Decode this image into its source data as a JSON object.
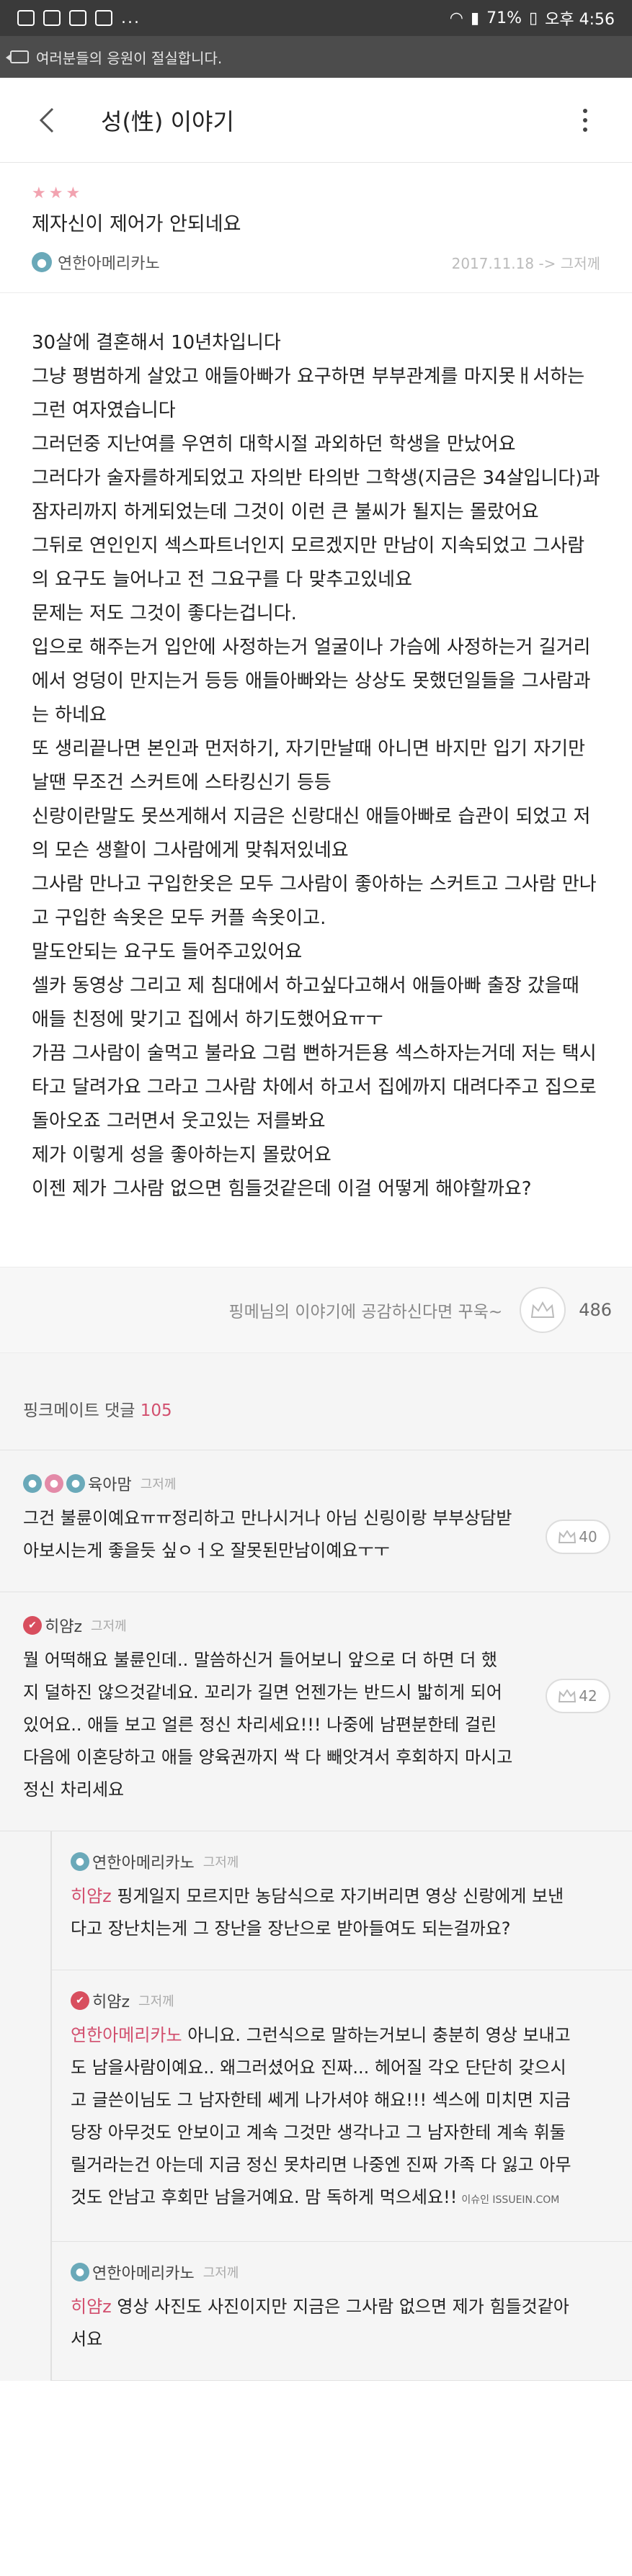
{
  "status_bar": {
    "time": "오후 4:56",
    "battery": "71%"
  },
  "notice": {
    "text": "여러분들의 응원이 절실합니다."
  },
  "header": {
    "title": "성(性) 이야기"
  },
  "post": {
    "title": "제자신이 제어가 안되네요",
    "author": "연한아메리카노",
    "date": "2017.11.18 -> 그저께",
    "paragraphs": [
      "30살에 결혼해서 10년차입니다",
      "그냥 평범하게 살았고 애들아빠가 요구하면 부부관계를 마지못ㅐ서하는 그런 여자였습니다",
      "그러던중 지난여를 우연히 대학시절 과외하던 학생을 만났어요",
      "그러다가 술자를하게되었고 자의반 타의반 그학생(지금은 34살입니다)과 잠자리까지 하게되었는데 그것이 이런 큰 불씨가 될지는 몰랐어요",
      "그뒤로 연인인지 섹스파트너인지 모르겠지만 만남이 지속되었고 그사람의 요구도 늘어나고 전 그요구를 다 맞추고있네요",
      "문제는 저도 그것이 좋다는겁니다.",
      "입으로 해주는거 입안에 사정하는거 얼굴이나 가슴에 사정하는거 길거리에서 엉덩이 만지는거 등등 애들아빠와는 상상도 못했던일들을 그사람과는 하네요",
      "또 생리끝나면 본인과 먼저하기, 자기만날때 아니면 바지만 입기 자기만날땐 무조건 스커트에 스타킹신기 등등",
      "신랑이란말도 못쓰게해서 지금은 신랑대신 애들아빠로 습관이 되었고 저의 모슨 생활이 그사람에게 맞춰저있네요",
      "그사람 만나고 구입한옷은 모두 그사람이 좋아하는 스커트고 그사람 만나고 구입한 속옷은 모두 커플 속옷이고.",
      "말도안되는 요구도 들어주고있어요",
      "셀카 동영상 그리고 제 침대에서 하고싶다고해서 애들아빠 출장 갔을때 애들 친정에 맞기고 집에서 하기도했어요ㅠㅜ",
      "가끔 그사람이 술먹고 불라요 그럼 뻔하거든용 섹스하자는거데 저는 택시타고 달려가요 그라고 그사람 차에서 하고서 집에까지 대려다주고 집으로 돌아오죠 그러면서 웃고있는 저를봐요",
      "제가 이렇게 성을 좋아하는지 몰랐어요",
      "이젠 제가 그사람 없으면 힘들것같은데 이걸 어떻게 해야할까요?"
    ]
  },
  "empathy": {
    "text": "핑메님의 이야기에 공감하신다면 꾸욱~",
    "count": "486"
  },
  "comments_section": {
    "label": "핑크메이트 댓글",
    "count": "105"
  },
  "comments": [
    {
      "author": "육아맘",
      "time": "그저께",
      "text": "그건 불륜이예요ㅠㅠ정리하고 만나시거나 아님 신링이랑 부부상담받아보시는게 좋을듯 싶ㅇㅓ오 잘못된만남이예요ㅜㅜ",
      "likes": "40"
    },
    {
      "author": "히얌z",
      "time": "그저께",
      "text": "뭘 어떡해요 불륜인데.. 말씀하신거 들어보니 앞으로 더 하면 더 했지 덜하진 않으것같네요. 꼬리가 길면 언젠가는 반드시 밟히게 되어있어요.. 애들 보고 얼른 정신 차리세요!!! 나중에 남편분한테 걸린 다음에 이혼당하고 애들 양육권까지 싹 다 빼앗겨서 후회하지 마시고 정신 차리세요",
      "likes": "42"
    }
  ],
  "replies": [
    {
      "author": "연한아메리카노",
      "time": "그저께",
      "mention": "히얌z",
      "text": " 핑게일지 모르지만 농담식으로 자기버리면 영상 신랑에게 보낸다고 장난치는게 그 장난을 장난으로 받아들여도 되는걸까요?"
    },
    {
      "author": "히얌z",
      "time": "그저께",
      "mention": "연한아메리카노",
      "text": " 아니요. 그런식으로 말하는거보니 충분히 영상 보내고도 남을사람이예요.. 왜그러셨어요 진짜... 헤어질 각오 단단히 갖으시고 글쓴이님도 그 남자한테 쎄게 나가셔야 해요!!! 섹스에 미치면 지금 당장 아무것도 안보이고 계속 그것만 생각나고 그 남자한테 계속 휘둘릴거라는건 아는데 지금 정신 못차리면 나중엔 진짜 가족 다 잃고 아무것도 안남고 후회만 남을거예요. 맘 독하게 먹으세요!!",
      "watermark": "이슈인 ISSUEIN.COM"
    },
    {
      "author": "연한아메리카노",
      "time": "그저께",
      "mention": "히얌z",
      "text": " 영상 사진도 사진이지만 지금은 그사람 없으면 제가 힘들것같아서요"
    }
  ]
}
